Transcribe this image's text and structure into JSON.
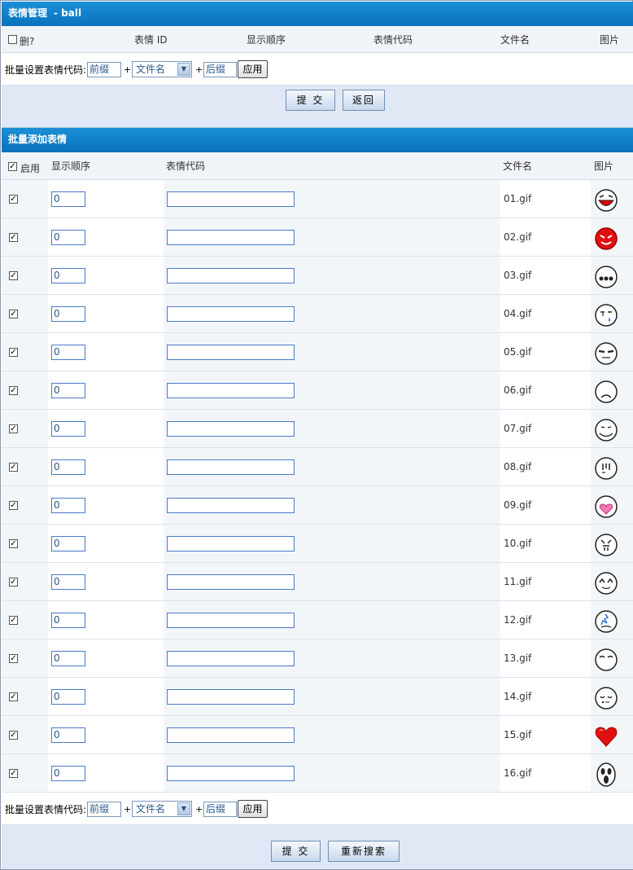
{
  "section1": {
    "title": "表情管理",
    "subtitle": "- ball",
    "headers": {
      "delete": "删?",
      "id": "表情 ID",
      "order": "显示顺序",
      "code": "表情代码",
      "filename": "文件名",
      "image": "图片"
    },
    "batch": {
      "label": "批量设置表情代码:",
      "prefix_value": "前缀",
      "plus1": "+",
      "select_value": "文件名",
      "plus2": "+",
      "suffix_value": "后缀",
      "apply_label": "应用"
    },
    "submit_label": "提 交",
    "back_label": "返回"
  },
  "section2": {
    "title": "批量添加表情",
    "headers": {
      "enable": "启用",
      "order": "显示顺序",
      "code": "表情代码",
      "filename": "文件名",
      "image": "图片"
    },
    "rows": [
      {
        "enabled": true,
        "order": "0",
        "code": "",
        "filename": "01.gif",
        "icon": "grin-face-icon"
      },
      {
        "enabled": true,
        "order": "0",
        "code": "",
        "filename": "02.gif",
        "icon": "devil-face-icon"
      },
      {
        "enabled": true,
        "order": "0",
        "code": "",
        "filename": "03.gif",
        "icon": "ellipsis-face-icon"
      },
      {
        "enabled": true,
        "order": "0",
        "code": "",
        "filename": "04.gif",
        "icon": "crying-face-icon"
      },
      {
        "enabled": true,
        "order": "0",
        "code": "",
        "filename": "05.gif",
        "icon": "cool-face-icon"
      },
      {
        "enabled": true,
        "order": "0",
        "code": "",
        "filename": "06.gif",
        "icon": "sad-face-icon"
      },
      {
        "enabled": true,
        "order": "0",
        "code": "",
        "filename": "07.gif",
        "icon": "drool-face-icon"
      },
      {
        "enabled": true,
        "order": "0",
        "code": "",
        "filename": "08.gif",
        "icon": "speechless-face-icon"
      },
      {
        "enabled": true,
        "order": "0",
        "code": "",
        "filename": "09.gif",
        "icon": "love-face-icon"
      },
      {
        "enabled": true,
        "order": "0",
        "code": "",
        "filename": "10.gif",
        "icon": "angry-face-icon"
      },
      {
        "enabled": true,
        "order": "0",
        "code": "",
        "filename": "11.gif",
        "icon": "happy-face-icon"
      },
      {
        "enabled": true,
        "order": "0",
        "code": "",
        "filename": "12.gif",
        "icon": "shocked-face-icon"
      },
      {
        "enabled": true,
        "order": "0",
        "code": "",
        "filename": "13.gif",
        "icon": "smirk-face-icon"
      },
      {
        "enabled": true,
        "order": "0",
        "code": "",
        "filename": "14.gif",
        "icon": "sleepy-face-icon"
      },
      {
        "enabled": true,
        "order": "0",
        "code": "",
        "filename": "15.gif",
        "icon": "heart-icon"
      },
      {
        "enabled": true,
        "order": "0",
        "code": "",
        "filename": "16.gif",
        "icon": "scream-face-icon"
      }
    ],
    "batch": {
      "label": "批量设置表情代码:",
      "prefix_value": "前缀",
      "plus1": "+",
      "select_value": "文件名",
      "plus2": "+",
      "suffix_value": "后缀",
      "apply_label": "应用"
    },
    "submit_label": "提 交",
    "research_label": "重新搜索"
  },
  "colors": {
    "header_blue": "#0a72bb",
    "action_bar": "#dfe8f4",
    "input_border": "#4a7ac8",
    "heart_red": "#e01010"
  }
}
